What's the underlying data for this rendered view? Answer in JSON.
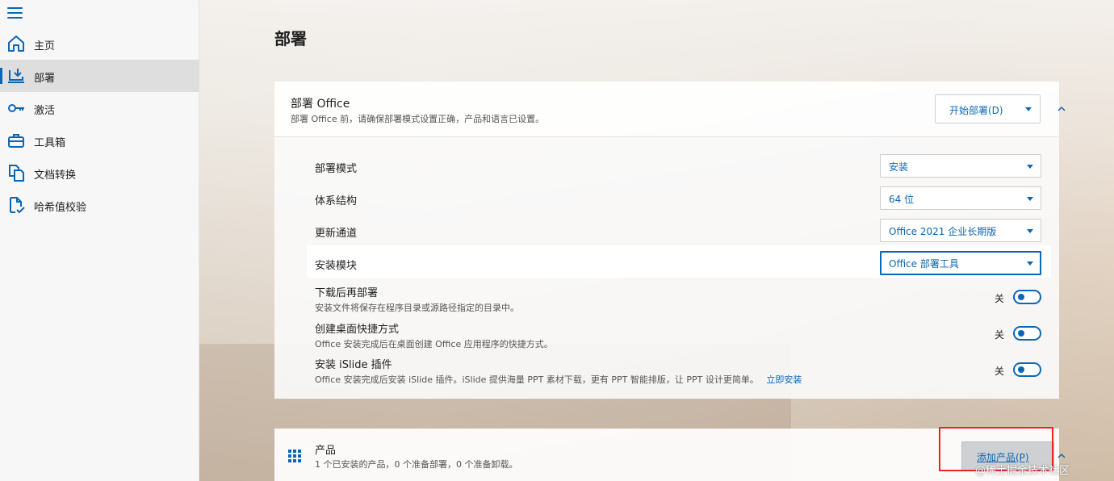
{
  "sidebar": {
    "items": [
      {
        "label": "主页",
        "icon": "home-icon"
      },
      {
        "label": "部署",
        "icon": "deploy-icon",
        "active": true
      },
      {
        "label": "激活",
        "icon": "key-icon"
      },
      {
        "label": "工具箱",
        "icon": "toolbox-icon"
      },
      {
        "label": "文档转换",
        "icon": "convert-icon"
      },
      {
        "label": "哈希值校验",
        "icon": "checksum-icon"
      }
    ]
  },
  "page": {
    "title": "部署"
  },
  "deploy_panel": {
    "title": "部署 Office",
    "subtitle": "部署 Office 前，请确保部署模式设置正确，产品和语言已设置。",
    "start_button_label": "开始部署(D)",
    "rows": [
      {
        "label": "部署模式",
        "value": "安装"
      },
      {
        "label": "体系结构",
        "value": "64 位"
      },
      {
        "label": "更新通道",
        "value": "Office 2021 企业长期版"
      },
      {
        "label": "安装模块",
        "value": "Office 部署工具"
      }
    ],
    "toggles": [
      {
        "label": "下载后再部署",
        "description": "安装文件将保存在程序目录或源路径指定的目录中。",
        "state": "关"
      },
      {
        "label": "创建桌面快捷方式",
        "description": "Office 安装完成后在桌面创建 Office 应用程序的快捷方式。",
        "state": "关"
      },
      {
        "label": "安装 iSlide 插件",
        "description": "Office 安装完成后安装 iSlide 插件。iSlide 提供海量 PPT 素材下载，更有 PPT 智能排版，让 PPT 设计更简单。",
        "link": "立即安装",
        "state": "关"
      }
    ]
  },
  "product_panel": {
    "title": "产品",
    "subtitle": "1 个已安装的产品，0 个准备部署，0 个准备卸载。",
    "add_button_label": "添加产品(P)"
  },
  "watermark": "@稀土掘金技术社区",
  "colors": {
    "accent": "#0a66b7",
    "highlight_box": "#e8262a"
  }
}
